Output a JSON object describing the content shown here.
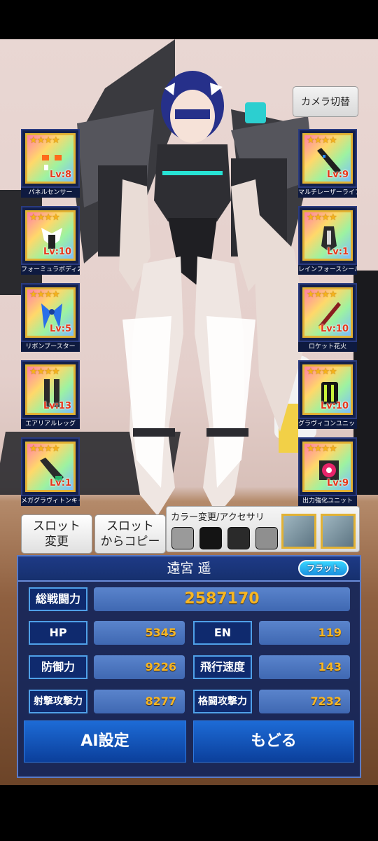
{
  "camera": {
    "label": "カメラ切替"
  },
  "slots_left": [
    {
      "label": "パネルセンサー",
      "level": "Lv:8",
      "stars": "★★★★"
    },
    {
      "label": "フォーミュラボディ2",
      "level": "Lv:10",
      "stars": "★★★★"
    },
    {
      "label": "リボンブースター",
      "level": "Lv:5",
      "stars": "★★★★"
    },
    {
      "label": "エアリアルレッグ",
      "level": "Lv:13",
      "stars": "★★★★"
    },
    {
      "label": "メガグラヴィトンキャノン",
      "level": "Lv:1",
      "stars": "★★★★"
    }
  ],
  "slots_right": [
    {
      "label": "マルチレーザーライフル",
      "level": "Lv:9",
      "stars": "★★★★"
    },
    {
      "label": "レインフォースシールド",
      "level": "Lv:1",
      "stars": "★★★★"
    },
    {
      "label": "ロケット花火",
      "level": "Lv:10",
      "stars": "★★★★"
    },
    {
      "label": "グラヴィコンユニット",
      "level": "Lv:10",
      "stars": "★★★★"
    },
    {
      "label": "出力強化ユニット",
      "level": "Lv:9",
      "stars": "★★★★"
    }
  ],
  "buttons": {
    "slot_change_line1": "スロット",
    "slot_change_line2": "変更",
    "slot_copy_line1": "スロット",
    "slot_copy_line2": "からコピー"
  },
  "color_panel": {
    "title": "カラー変更/アクセサリ",
    "swatches": [
      "#9a9a9a",
      "#141414",
      "#2a2a2a",
      "#8f8f8f"
    ]
  },
  "character": {
    "name": "遠宮 遥",
    "badge": "フラット"
  },
  "stats": {
    "total_label": "総戦闘力",
    "total_value": "2587170",
    "hp_label": "HP",
    "hp_value": "5345",
    "en_label": "EN",
    "en_value": "119",
    "def_label": "防御力",
    "def_value": "9226",
    "speed_label": "飛行速度",
    "speed_value": "143",
    "shoot_label": "射撃攻撃力",
    "shoot_value": "8277",
    "melee_label": "格闘攻撃力",
    "melee_value": "7232"
  },
  "actions": {
    "ai_label": "AI設定",
    "back_label": "もどる"
  }
}
